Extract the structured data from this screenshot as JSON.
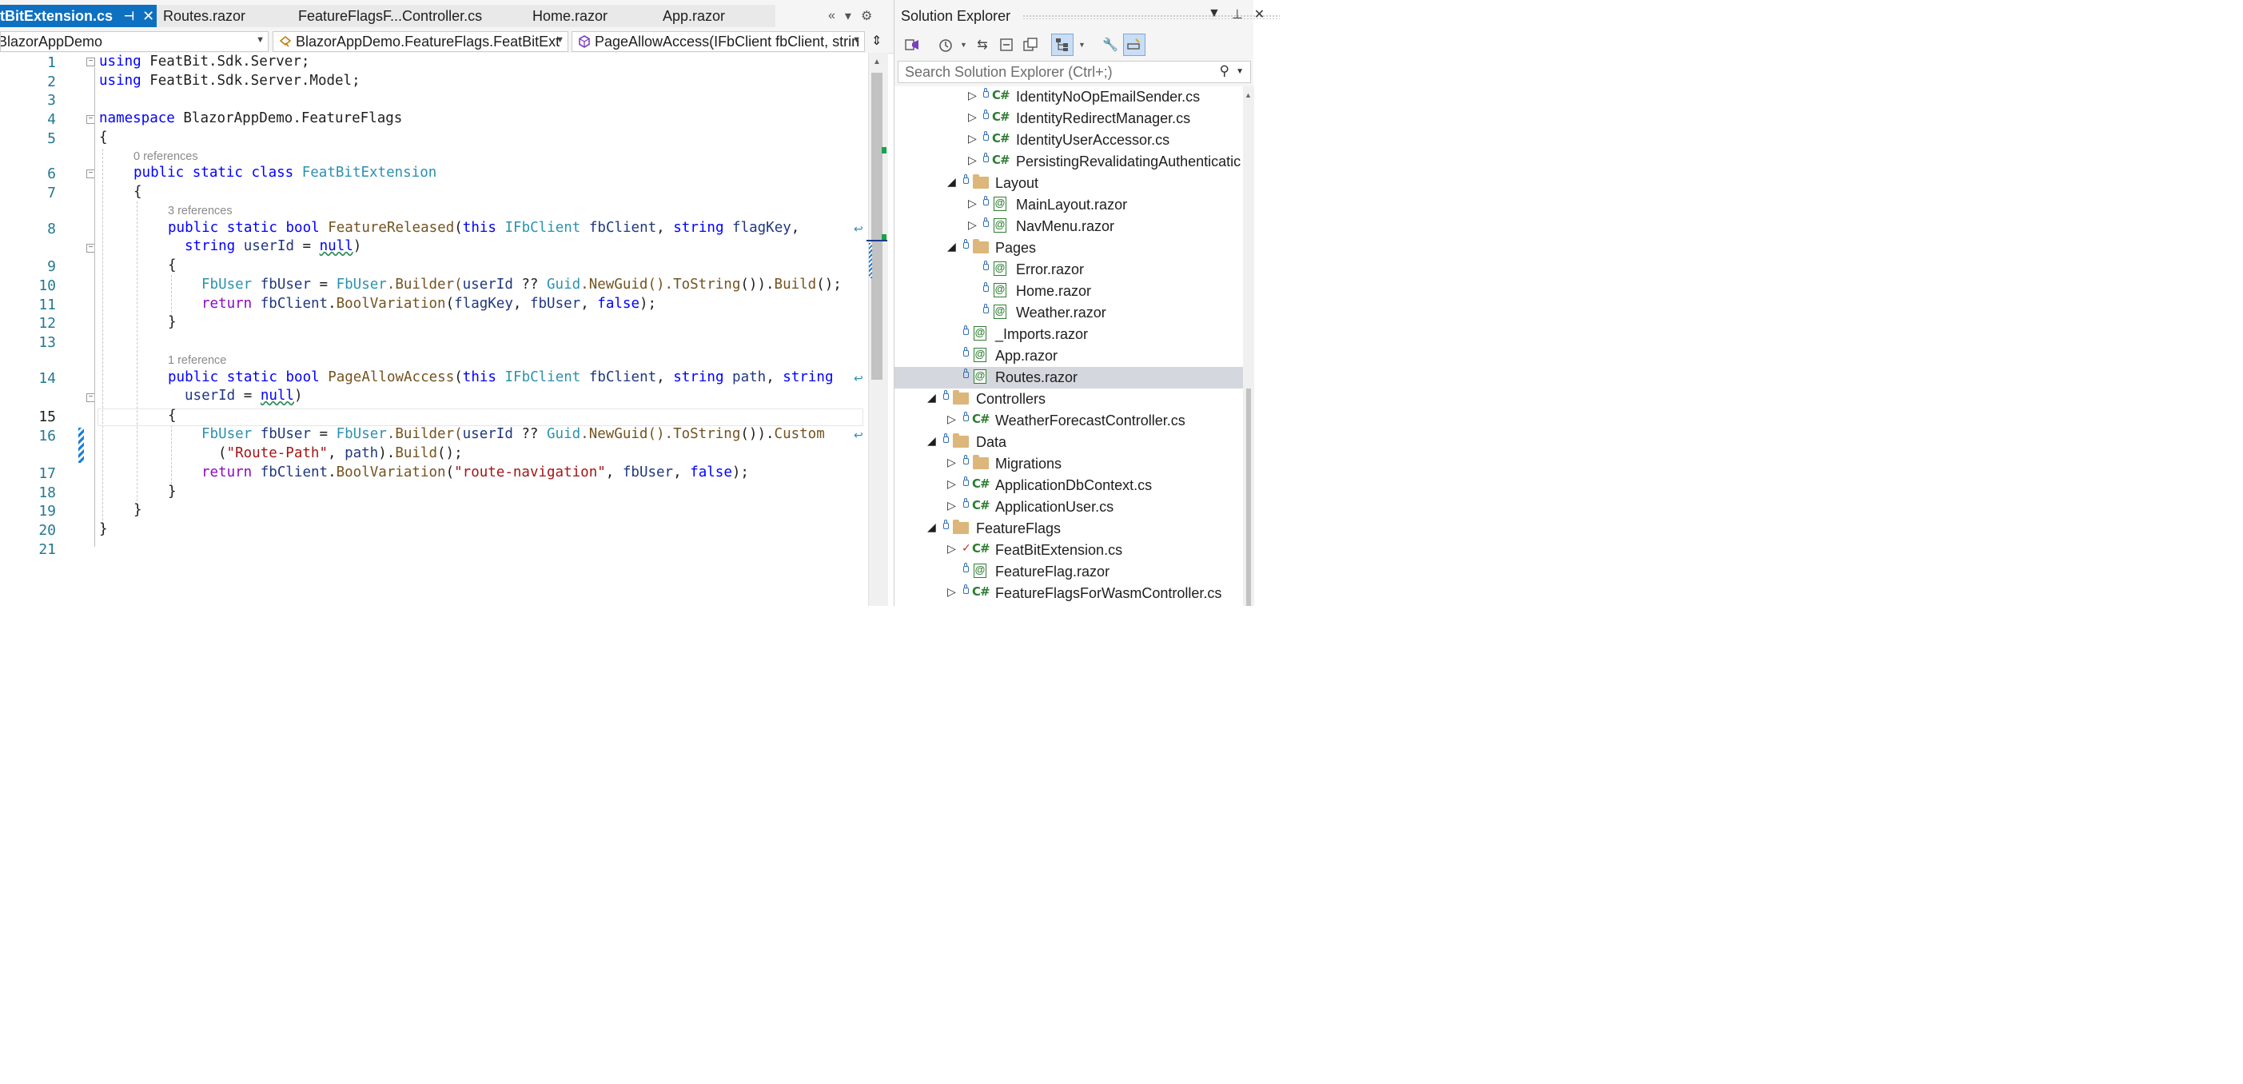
{
  "tabs": [
    {
      "label": "tBitExtension.cs",
      "active": true
    },
    {
      "label": "Routes.razor"
    },
    {
      "label": "FeatureFlagsF...Controller.cs"
    },
    {
      "label": "Home.razor"
    },
    {
      "label": "App.razor"
    }
  ],
  "navbar": {
    "project": "BlazorAppDemo",
    "type": "BlazorAppDemo.FeatureFlags.FeatBitExt",
    "member": "PageAllowAccess(IFbClient fbClient, strin"
  },
  "code": {
    "line_numbers": [
      "1",
      "2",
      "3",
      "4",
      "5",
      "6",
      "7",
      "8",
      "9",
      "10",
      "11",
      "12",
      "13",
      "14",
      "15",
      "16",
      "17",
      "18",
      "19",
      "20",
      "21"
    ],
    "current_line": "15",
    "codelens": {
      "class_refs": "0 references",
      "feature_released_refs": "3 references",
      "page_allow_refs": "1 reference"
    },
    "tokens": {
      "using": "using",
      "ns1": "FeatBit.Sdk.Server;",
      "ns2": "FeatBit.Sdk.Server.Model;",
      "namespace": "namespace",
      "ns_name": "BlazorAppDemo.FeatureFlags",
      "open_brace": "{",
      "close_brace": "}",
      "public_static_class": "public static class",
      "class_name": "FeatBitExtension",
      "public_static_bool": "public static bool",
      "m1_name": "FeatureReleased",
      "m2_name": "PageAllowAccess",
      "open_paren": "(",
      "this": "this",
      "ifbclient": "IFbClient",
      "fbclient": "fbClient",
      "comma": ",",
      "string": "string",
      "flagkey": "flagKey",
      "userid": "userId",
      "eq": " = ",
      "null": "null",
      "close_paren": ")",
      "path": "path",
      "fbuser_type": "FbUser",
      "fbuser_var": "fbUser",
      "builder_call": ".Builder(",
      "coalesce": " ?? ",
      "guid": "Guid",
      "newguid": ".NewGuid().",
      "tostring": "ToString",
      "after_tostring": "()).",
      "build": "Build",
      "end_call": "();",
      "custom": "Custom",
      "return": "return",
      "dot": ".",
      "boolvar": "BoolVariation",
      "false": "false",
      "end_stmt": ");",
      "route_path": "\"Route-Path\"",
      "route_nav": "\"route-navigation\"",
      "paren_close_dot": ").",
      "build_end": "();"
    }
  },
  "solution_explorer": {
    "title": "Solution Explorer",
    "search_placeholder": "Search Solution Explorer (Ctrl+;)",
    "cs_badge": "C#",
    "razor_badge": "@",
    "items": [
      {
        "label": "IdentityNoOpEmailSender.cs",
        "kind": "cs"
      },
      {
        "label": "IdentityRedirectManager.cs",
        "kind": "cs"
      },
      {
        "label": "IdentityUserAccessor.cs",
        "kind": "cs"
      },
      {
        "label": "PersistingRevalidatingAuthenticatic",
        "kind": "cs"
      },
      {
        "label": "Layout",
        "kind": "folder"
      },
      {
        "label": "MainLayout.razor",
        "kind": "razor"
      },
      {
        "label": "NavMenu.razor",
        "kind": "razor"
      },
      {
        "label": "Pages",
        "kind": "folder"
      },
      {
        "label": "Error.razor",
        "kind": "razor"
      },
      {
        "label": "Home.razor",
        "kind": "razor"
      },
      {
        "label": "Weather.razor",
        "kind": "razor"
      },
      {
        "label": "_Imports.razor",
        "kind": "razor"
      },
      {
        "label": "App.razor",
        "kind": "razor"
      },
      {
        "label": "Routes.razor",
        "kind": "razor",
        "selected": true
      },
      {
        "label": "Controllers",
        "kind": "folder"
      },
      {
        "label": "WeatherForecastController.cs",
        "kind": "cs"
      },
      {
        "label": "Data",
        "kind": "folder"
      },
      {
        "label": "Migrations",
        "kind": "folder"
      },
      {
        "label": "ApplicationDbContext.cs",
        "kind": "cs"
      },
      {
        "label": "ApplicationUser.cs",
        "kind": "cs"
      },
      {
        "label": "FeatureFlags",
        "kind": "folder"
      },
      {
        "label": "FeatBitExtension.cs",
        "kind": "cs",
        "status": "checked"
      },
      {
        "label": "FeatureFlag.razor",
        "kind": "razor"
      },
      {
        "label": "FeatureFlagsForWasmController.cs",
        "kind": "cs"
      }
    ]
  },
  "colors": {
    "active_tab": "#0e70c0",
    "keyword": "#0000ff",
    "type": "#2b91af",
    "method": "#74531f",
    "string": "#a31515",
    "control": "#8f08c4",
    "selection": "#d4d7de"
  }
}
